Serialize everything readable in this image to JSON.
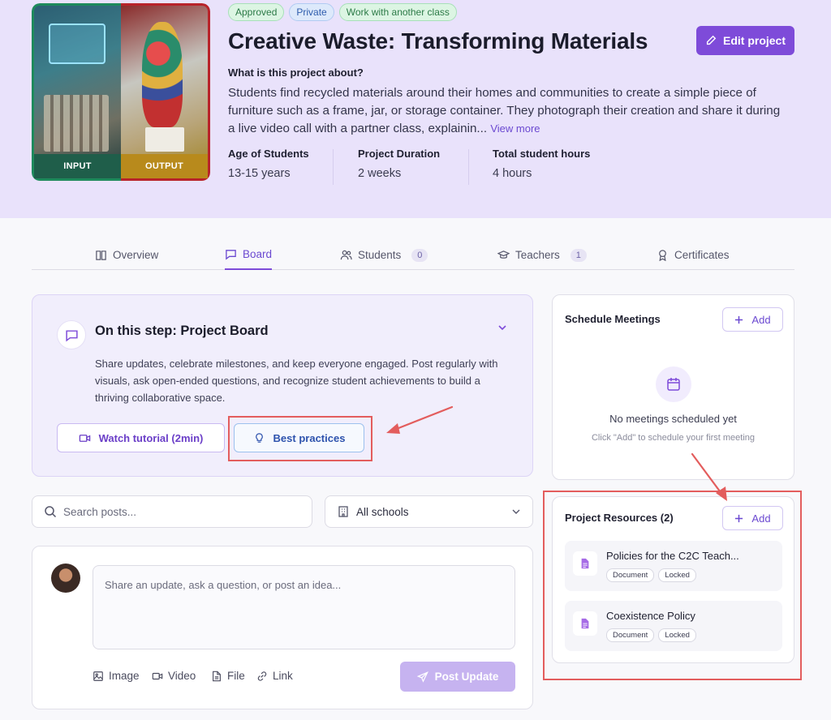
{
  "project": {
    "badges": [
      "Approved",
      "Private",
      "Work with another class"
    ],
    "title": "Creative Waste: Transforming Materials",
    "edit_label": "Edit project",
    "about_heading": "What is this project about?",
    "about_text": "Students find recycled materials around their homes and communities to create a simple piece of furniture such as a frame, jar, or storage container. They photograph their creation and share it during a live video call with a partner class, explainin...",
    "view_more": "View more",
    "cover": {
      "input_label": "INPUT",
      "output_label": "OUTPUT"
    },
    "meta": [
      {
        "label": "Age of Students",
        "value": "13-15 years"
      },
      {
        "label": "Project Duration",
        "value": "2 weeks"
      },
      {
        "label": "Total student hours",
        "value": "4 hours"
      }
    ]
  },
  "tabs": [
    {
      "label": "Overview",
      "icon": "book-icon",
      "count": ""
    },
    {
      "label": "Board",
      "icon": "chat-icon",
      "count": "",
      "active": true
    },
    {
      "label": "Students",
      "icon": "users-icon",
      "count": "0"
    },
    {
      "label": "Teachers",
      "icon": "graduation-cap-icon",
      "count": "1"
    },
    {
      "label": "Certificates",
      "icon": "award-icon",
      "count": ""
    }
  ],
  "step": {
    "title": "On this step: Project Board",
    "description": "Share updates, celebrate milestones, and keep everyone engaged. Post regularly with visuals, ask open-ended questions, and recognize student achievements to build a thriving collaborative space.",
    "tutorial_label": "Watch tutorial (2min)",
    "best_practices_label": "Best practices"
  },
  "search": {
    "placeholder": "Search posts..."
  },
  "filter": {
    "selected": "All schools"
  },
  "composer": {
    "placeholder": "Share an update, ask a question, or post an idea...",
    "attachments": [
      "Image",
      "Video",
      "File",
      "Link"
    ],
    "post_label": "Post Update"
  },
  "meetings": {
    "title": "Schedule Meetings",
    "add_label": "Add",
    "empty_title": "No meetings scheduled yet",
    "empty_hint": "Click \"Add\" to schedule your first meeting"
  },
  "resources": {
    "title": "Project Resources (2)",
    "add_label": "Add",
    "items": [
      {
        "name": "Policies for the C2C Teach...",
        "tags": [
          "Document",
          "Locked"
        ]
      },
      {
        "name": "Coexistence Policy",
        "tags": [
          "Document",
          "Locked"
        ]
      }
    ]
  },
  "colors": {
    "accent": "#7e4bd9",
    "hero_bg": "#e9e2fb",
    "highlight": "#e35d5d"
  }
}
